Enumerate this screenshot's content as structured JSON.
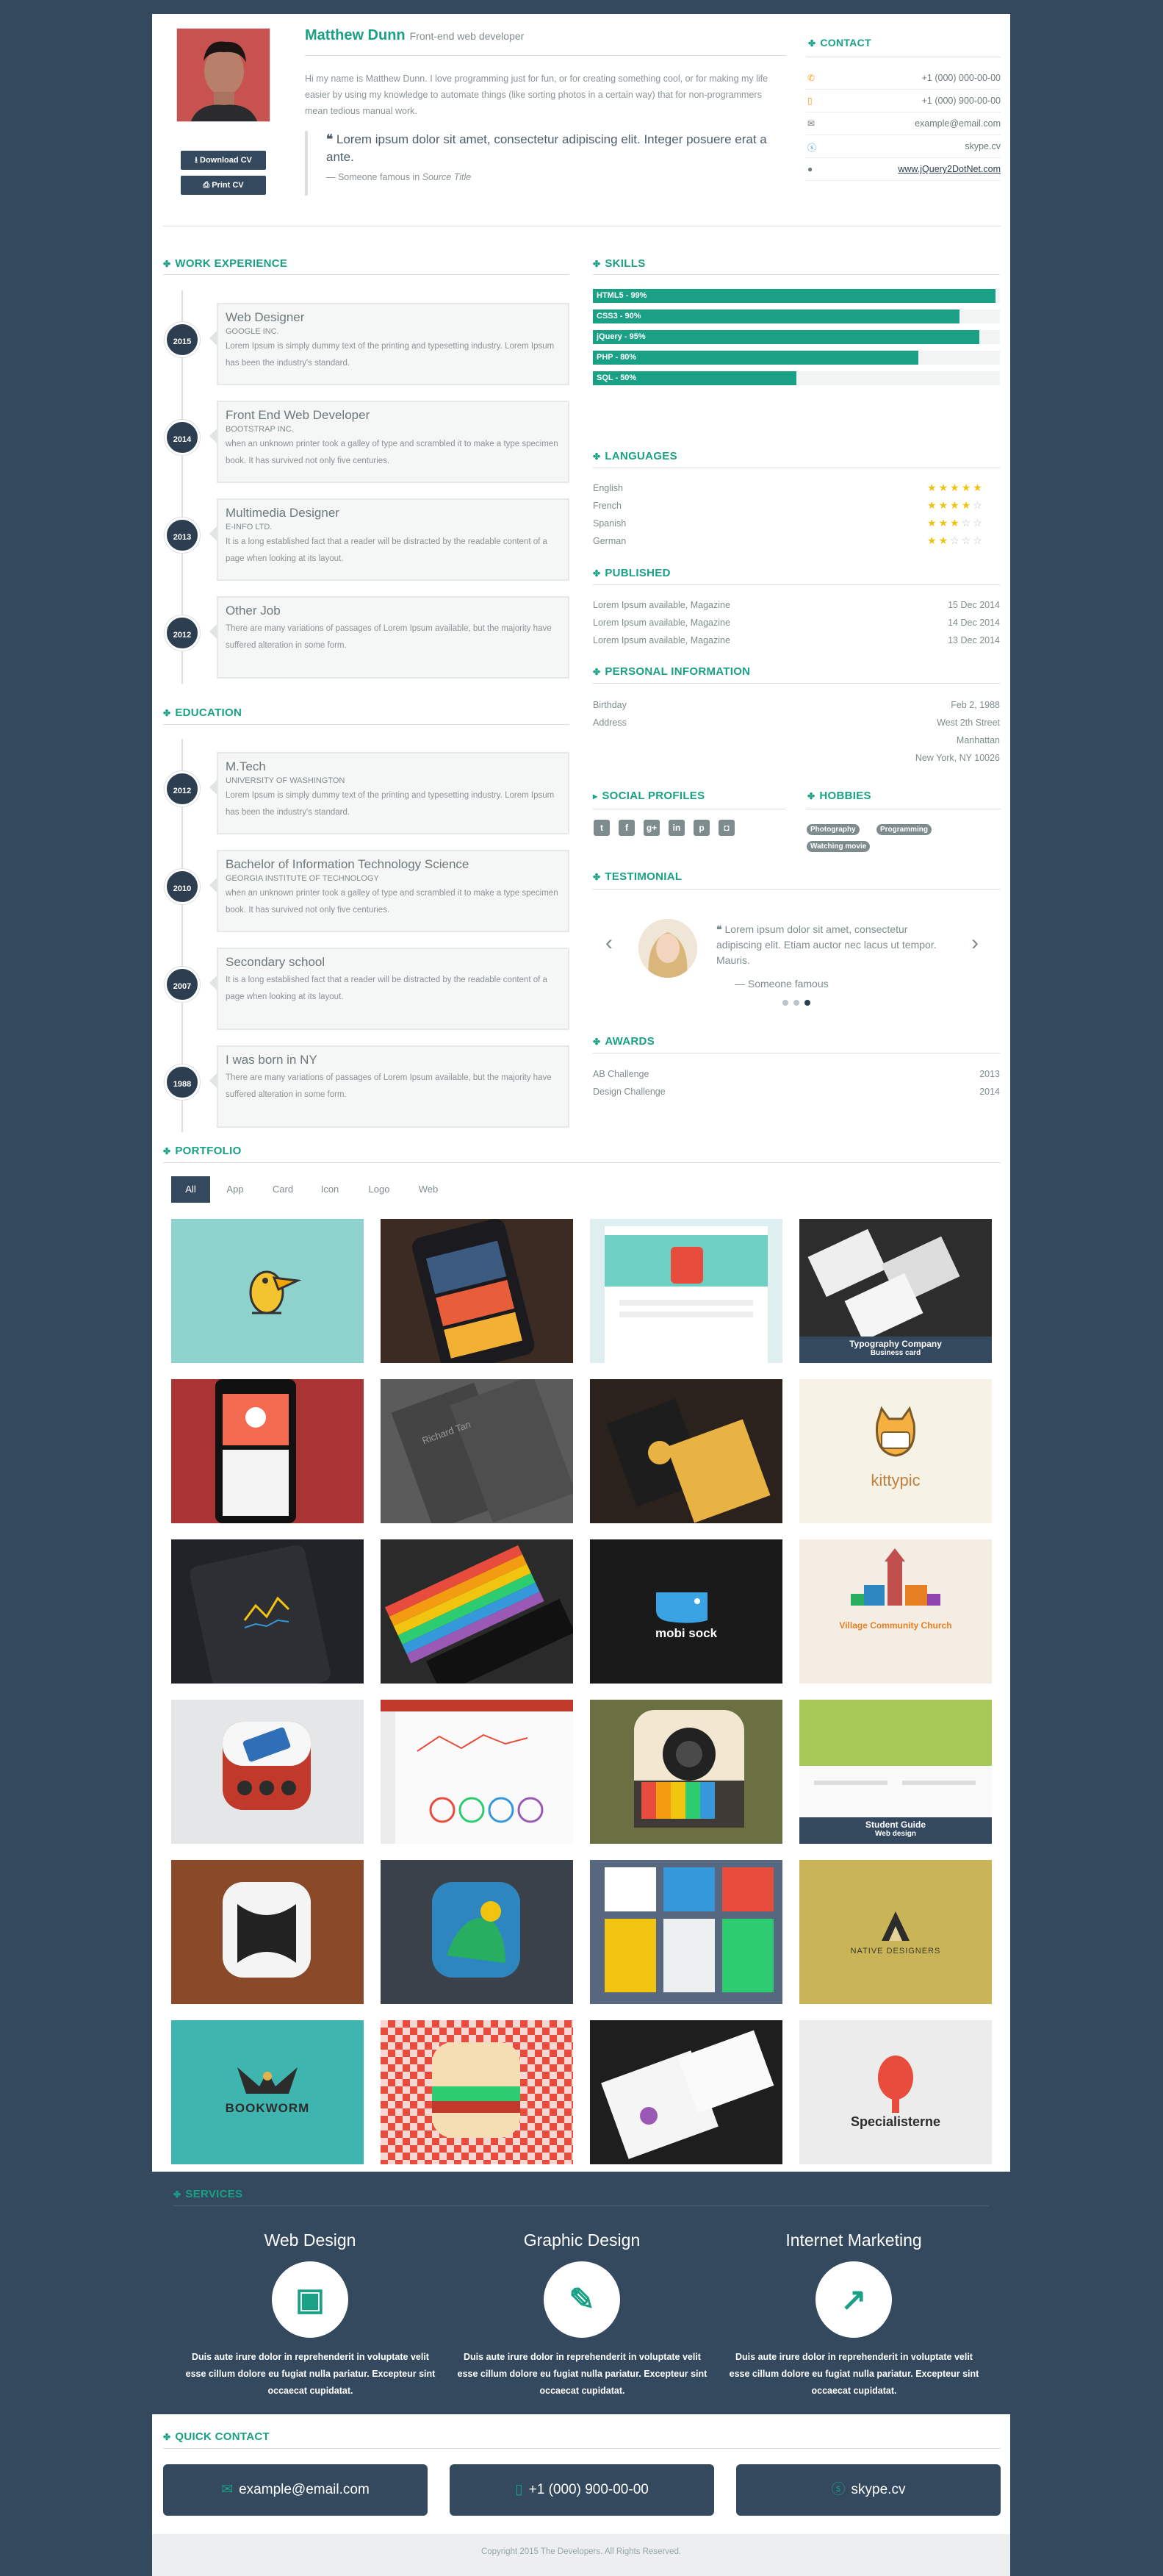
{
  "profile": {
    "name": "Matthew Dunn",
    "role": "Front-end web developer",
    "intro": "Hi my name is Matthew Dunn. I love programming just for fun, or for creating something cool, or for making my life easier by using my knowledge to automate things (like sorting photos in a certain way) that for non-programmers mean tedious manual work.",
    "quote": "Lorem ipsum dolor sit amet, consectetur adipiscing elit. Integer posuere erat a ante.",
    "quote_source_prefix": "— Someone famous in",
    "quote_source_title": "Source Title",
    "download_label": "Download CV",
    "print_label": "Print CV"
  },
  "contact": {
    "title": "CONTACT",
    "phone": "+1 (000) 000-00-00",
    "mobile": "+1 (000) 900-00-00",
    "email": "example@email.com",
    "skype": "skype.cv",
    "website": "www.jQuery2DotNet.com"
  },
  "work": {
    "title": "WORK EXPERIENCE",
    "items": [
      {
        "year": "2015",
        "title": "Web Designer",
        "org": "GOOGLE INC.",
        "desc": "Lorem Ipsum is simply dummy text of the printing and typesetting industry. Lorem Ipsum has been the industry's standard."
      },
      {
        "year": "2014",
        "title": "Front End Web Developer",
        "org": "BOOTSTRAP INC.",
        "desc": "when an unknown printer took a galley of type and scrambled it to make a type specimen book. It has survived not only five centuries."
      },
      {
        "year": "2013",
        "title": "Multimedia Designer",
        "org": "E-INFO LTD.",
        "desc": "It is a long established fact that a reader will be distracted by the readable content of a page when looking at its layout."
      },
      {
        "year": "2012",
        "title": "Other Job",
        "org": "",
        "desc": "There are many variations of passages of Lorem Ipsum available, but the majority have suffered alteration in some form."
      }
    ]
  },
  "education": {
    "title": "EDUCATION",
    "items": [
      {
        "year": "2012",
        "title": "M.Tech",
        "org": "UNIVERSITY OF WASHINGTON",
        "desc": "Lorem Ipsum is simply dummy text of the printing and typesetting industry. Lorem Ipsum has been the industry's standard."
      },
      {
        "year": "2010",
        "title": "Bachelor of Information Technology Science",
        "org": "GEORGIA INSTITUTE OF TECHNOLOGY",
        "desc": "when an unknown printer took a galley of type and scrambled it to make a type specimen book. It has survived not only five centuries."
      },
      {
        "year": "2007",
        "title": "Secondary school",
        "org": "",
        "desc": "It is a long established fact that a reader will be distracted by the readable content of a page when looking at its layout."
      },
      {
        "year": "1988",
        "title": "I was born in NY",
        "org": "",
        "desc": "There are many variations of passages of Lorem Ipsum available, but the majority have suffered alteration in some form."
      }
    ]
  },
  "skills": {
    "title": "SKILLS",
    "items": [
      {
        "label": "HTML5 - 99%",
        "level": 0.99
      },
      {
        "label": "CSS3 - 90%",
        "level": 0.9
      },
      {
        "label": "jQuery - 95%",
        "level": 0.95
      },
      {
        "label": "PHP - 80%",
        "level": 0.8
      },
      {
        "label": "SQL - 50%",
        "level": 0.5
      }
    ]
  },
  "languages": {
    "title": "LANGUAGES",
    "items": [
      {
        "name": "English",
        "stars": 5
      },
      {
        "name": "French",
        "stars": 4
      },
      {
        "name": "Spanish",
        "stars": 3
      },
      {
        "name": "German",
        "stars": 2
      }
    ]
  },
  "published": {
    "title": "PUBLISHED",
    "items": [
      {
        "name": "Lorem Ipsum available, Magazine",
        "date": "15 Dec 2014"
      },
      {
        "name": "Lorem Ipsum available, Magazine",
        "date": "14 Dec 2014"
      },
      {
        "name": "Lorem Ipsum available, Magazine",
        "date": "13 Dec 2014"
      }
    ]
  },
  "personal": {
    "title": "PERSONAL INFORMATION",
    "birthday_label": "Birthday",
    "birthday": "Feb 2, 1988",
    "address_label": "Address",
    "address_lines": [
      "West 2th Street",
      "Manhattan",
      "New York, NY 10026"
    ]
  },
  "social": {
    "title": "SOCIAL PROFILES",
    "icons": [
      "twitter-icon",
      "facebook-icon",
      "google-plus-icon",
      "linkedin-icon",
      "pinterest-icon",
      "instagram-icon"
    ]
  },
  "hobbies": {
    "title": "HOBBIES",
    "items": [
      "Photography",
      "Programming",
      "Watching movie"
    ]
  },
  "testimonial": {
    "title": "TESTIMONIAL",
    "text": "Lorem ipsum dolor sit amet, consectetur adipiscing elit. Etiam auctor nec lacus ut tempor. Mauris.",
    "author": "— Someone famous"
  },
  "awards": {
    "title": "AWARDS",
    "items": [
      {
        "name": "AB Challenge",
        "year": "2013"
      },
      {
        "name": "Design Challenge",
        "year": "2014"
      }
    ]
  },
  "portfolio": {
    "title": "PORTFOLIO",
    "filters": [
      "All",
      "App",
      "Card",
      "Icon",
      "Logo",
      "Web"
    ],
    "captions": {
      "typography": {
        "title": "Typography Company",
        "sub": "Business card"
      },
      "kittypic": "kittypic",
      "mobisock": "mobi sock",
      "church": "Village Community Church",
      "student": {
        "title": "Student Guide",
        "sub": "Web design"
      },
      "native": "NATIVE DESIGNERS",
      "bookworm": "BOOKWORM",
      "specialisterne": "Specialisterne",
      "richard": "Richard Tan"
    }
  },
  "services": {
    "title": "SERVICES",
    "items": [
      {
        "title": "Web Design",
        "text": "Duis aute irure dolor in reprehenderit in voluptate velit esse cillum dolore eu fugiat nulla pariatur. Excepteur sint occaecat cupidatat."
      },
      {
        "title": "Graphic Design",
        "text": "Duis aute irure dolor in reprehenderit in voluptate velit esse cillum dolore eu fugiat nulla pariatur. Excepteur sint occaecat cupidatat."
      },
      {
        "title": "Internet Marketing",
        "text": "Duis aute irure dolor in reprehenderit in voluptate velit esse cillum dolore eu fugiat nulla pariatur. Excepteur sint occaecat cupidatat."
      }
    ]
  },
  "quick_contact": {
    "title": "QUICK CONTACT",
    "email": "example@email.com",
    "phone": "+1 (000) 900-00-00",
    "skype": "skype.cv"
  },
  "footer": {
    "copyright": "Copyright 2015 The Developers. All Rights Reserved."
  },
  "colors": {
    "accent": "#1aa085",
    "dark": "#34495e",
    "star": "#f1c40f"
  }
}
